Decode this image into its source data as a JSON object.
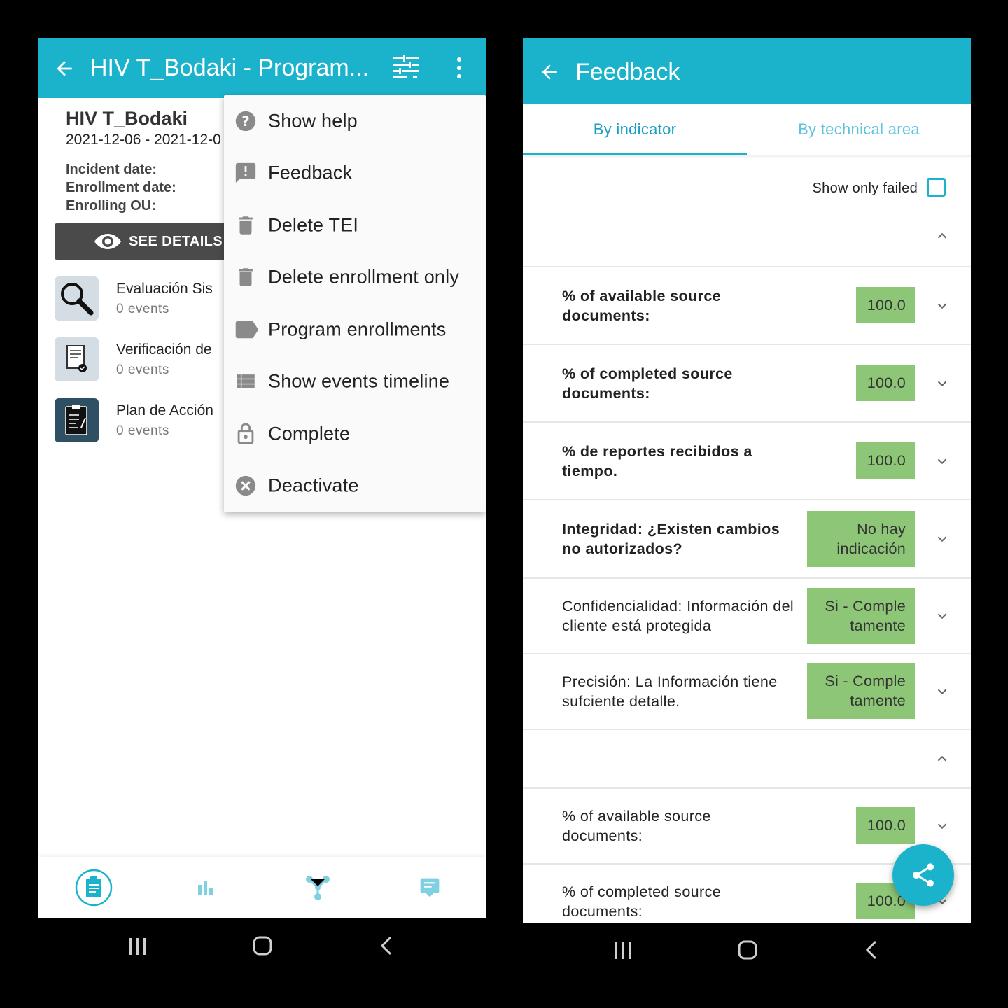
{
  "left": {
    "title": "HIV T_Bodaki - Program...",
    "tei": {
      "name": "HIV T_Bodaki",
      "dates": "2021-12-06 - 2021-12-0",
      "incident_label": "Incident date:",
      "enrollment_label": "Enrollment date:",
      "ou_label": "Enrolling OU:"
    },
    "see_details": "SEE DETAILS",
    "stages": [
      {
        "name": "Evaluación Sis",
        "count": "0 events",
        "icon": "magnifier-icon"
      },
      {
        "name": "Verificación de",
        "count": "0 events",
        "icon": "document-check-icon"
      },
      {
        "name": "Plan de Acción",
        "count": "0 events",
        "icon": "clipboard-icon"
      }
    ],
    "menu": [
      {
        "label": "Show help",
        "icon": "help-icon"
      },
      {
        "label": "Feedback",
        "icon": "feedback-icon"
      },
      {
        "label": "Delete TEI",
        "icon": "trash-icon"
      },
      {
        "label": "Delete enrollment only",
        "icon": "trash-icon"
      },
      {
        "label": "Program enrollments",
        "icon": "label-icon"
      },
      {
        "label": "Show events timeline",
        "icon": "list-icon"
      },
      {
        "label": "Complete",
        "icon": "lock-icon"
      },
      {
        "label": "Deactivate",
        "icon": "cancel-icon"
      }
    ],
    "bottom_nav": [
      "clipboard-icon",
      "bar-chart-icon",
      "relationships-icon",
      "notes-icon"
    ]
  },
  "right": {
    "title": "Feedback",
    "tabs": {
      "active": "By indicator",
      "inactive": "By technical area"
    },
    "filter_label": "Show only failed",
    "rows": [
      {
        "label": "% of available source documents:",
        "value": "100.0",
        "bold": true
      },
      {
        "label": "% of completed source documents:",
        "value": "100.0",
        "bold": true
      },
      {
        "label": "% de reportes recibidos a tiempo.",
        "value": "100.0",
        "bold": true
      },
      {
        "label": "Integridad: ¿Existen cambios no autorizados?",
        "value": "No hay indicación",
        "bold": true
      },
      {
        "label": "Confidencialidad: Información del cliente está protegida",
        "value": "Si - Comple tamente",
        "bold": false
      },
      {
        "label": "Precisión: La Información tiene sufciente detalle.",
        "value": "Si - Comple tamente",
        "bold": false
      },
      {
        "label": "% of available source documents:",
        "value": "100.0",
        "bold": false
      },
      {
        "label": "% of completed source documents:",
        "value": "100.0",
        "bold": false
      }
    ]
  },
  "colors": {
    "primary": "#1bb3cc",
    "pass_green": "#8dc677",
    "see_details_bg": "#4a4a4a"
  }
}
